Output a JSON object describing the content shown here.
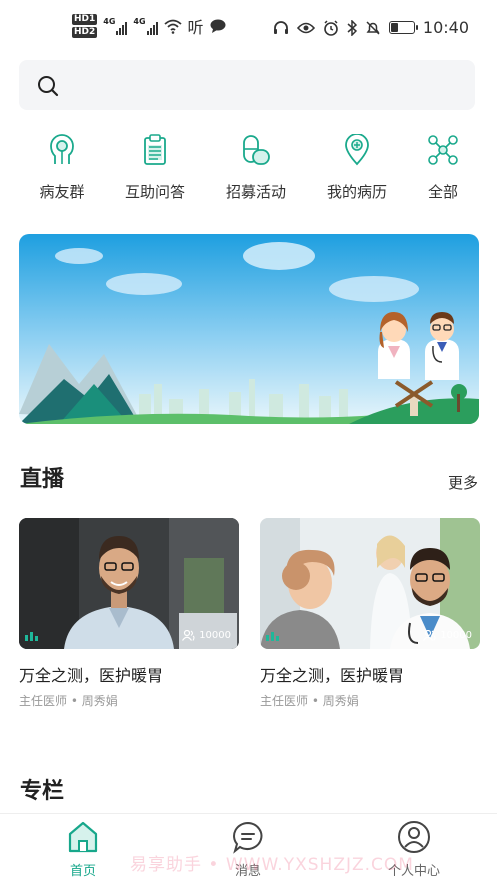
{
  "status_bar": {
    "hd1": "HD1",
    "hd2": "HD2",
    "net1": "4G",
    "net2": "4G",
    "listen": "听",
    "time": "10:40",
    "battery_level": 0.3
  },
  "search": {
    "placeholder": ""
  },
  "quick_nav": [
    {
      "icon": "head-icon",
      "label": "病友群"
    },
    {
      "icon": "clipboard-icon",
      "label": "互助问答"
    },
    {
      "icon": "capsule-icon",
      "label": "招募活动"
    },
    {
      "icon": "location-pin-icon",
      "label": "我的病历"
    },
    {
      "icon": "network-icon",
      "label": "全部"
    }
  ],
  "live": {
    "title": "直播",
    "more": "更多",
    "cards": [
      {
        "title": "万全之测，医护暖胃",
        "subtitle": "主任医师 • 周秀娟",
        "views": "10000"
      },
      {
        "title": "万全之测，医护暖胃",
        "subtitle": "主任医师 • 周秀娟",
        "views": "10000"
      }
    ]
  },
  "column": {
    "title": "专栏"
  },
  "tabbar": {
    "items": [
      {
        "label": "首页",
        "icon": "home-icon",
        "active": true
      },
      {
        "label": "消息",
        "icon": "message-icon",
        "active": false
      },
      {
        "label": "个人中心",
        "icon": "user-icon",
        "active": false
      }
    ]
  },
  "watermark": "易享助手 • WWW.YXSHZJZ.COM",
  "colors": {
    "accent": "#17a78b",
    "teal": "#1fb89a"
  }
}
